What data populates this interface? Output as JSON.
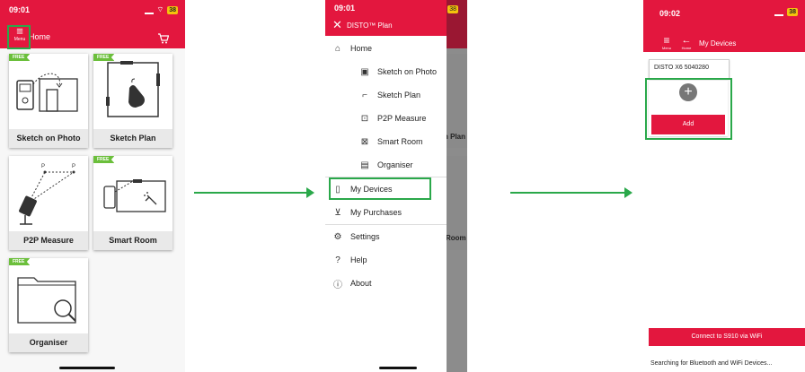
{
  "colors": {
    "accent": "#e3173e",
    "highlight": "#2aa84a",
    "free_badge": "#6bbf3b"
  },
  "screen1": {
    "time": "09:01",
    "battery": "38",
    "menu_label": "Menu",
    "title": "Home",
    "free_badge": "FREE",
    "tiles": [
      {
        "label": "Sketch on Photo"
      },
      {
        "label": "Sketch Plan"
      },
      {
        "label": "P2P Measure"
      },
      {
        "label": "Smart Room"
      },
      {
        "label": "Organiser"
      }
    ],
    "p2p_labels": [
      "P",
      "P"
    ]
  },
  "screen2": {
    "time": "09:01",
    "battery": "38",
    "app_title": "DISTO™ Plan",
    "menu": {
      "home": "Home",
      "sketch_on_photo": "Sketch on Photo",
      "sketch_plan": "Sketch Plan",
      "p2p_measure": "P2P Measure",
      "smart_room": "Smart Room",
      "organiser": "Organiser",
      "my_devices": "My Devices",
      "my_purchases": "My Purchases",
      "settings": "Settings",
      "help": "Help",
      "about": "About"
    },
    "background_labels": [
      "h Plan",
      "Room"
    ]
  },
  "screen3": {
    "time": "09:02",
    "battery": "38",
    "menu_label": "Menu",
    "home_label": "Home",
    "title": "My Devices",
    "device_name": "DISTO X6 5040280",
    "add_label": "Add",
    "connect_label": "Connect to S910 via WiFi",
    "searching_text": "Searching for Bluetooth and WiFi Devices..."
  }
}
